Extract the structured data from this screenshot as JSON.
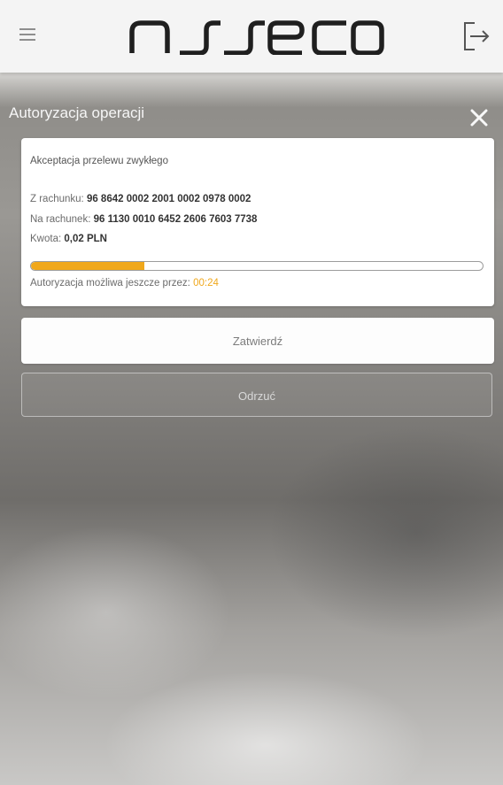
{
  "header": {
    "brand": "asseco",
    "menu_icon": "hamburger-menu-icon",
    "logout_icon": "logout-icon"
  },
  "modal": {
    "title": "Autoryzacja operacji",
    "close_icon": "close-icon"
  },
  "card": {
    "heading": "Akceptacja przelewu zwykłego",
    "from_label": "Z rachunku:",
    "from_value": "96 8642 0002 2001 0002 0978 0002",
    "to_label": "Na rachunek:",
    "to_value": "96 1130 0010 6452 2606 7603 7738",
    "amount_label": "Kwota:",
    "amount_value": "0,02 PLN",
    "progress_fraction": 0.25,
    "timer_label": "Autoryzacja możliwa jeszcze przez:",
    "timer_value": "00:24"
  },
  "actions": {
    "confirm_label": "Zatwierdź",
    "reject_label": "Odrzuć"
  },
  "colors": {
    "accent": "#f0a81c"
  }
}
